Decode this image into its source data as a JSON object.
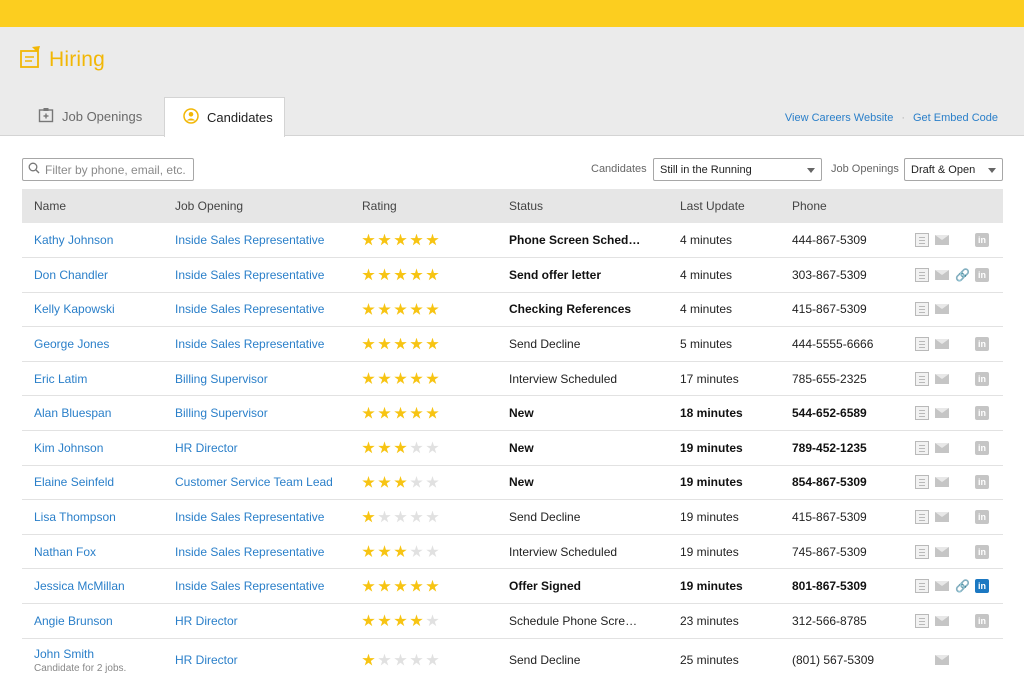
{
  "app": {
    "title": "Hiring"
  },
  "tabs": {
    "jobs": "Job Openings",
    "candidates": "Candidates"
  },
  "links": {
    "careers": "View Careers Website",
    "separator": "·",
    "embed": "Get Embed Code"
  },
  "filter": {
    "placeholder": "Filter by phone, email, etc..."
  },
  "selects": {
    "candidates_label": "Candidates",
    "candidates_value": "Still in the Running",
    "jobs_label": "Job Openings",
    "jobs_value": "Draft & Open"
  },
  "table": {
    "headers": [
      "Name",
      "Job Opening",
      "Rating",
      "Status",
      "Last Update",
      "Phone"
    ],
    "rows": [
      {
        "name": "Kathy Johnson",
        "job": "Inside Sales Representative",
        "rating": 5,
        "status": "Phone Screen Sched…",
        "update": "4 minutes",
        "phone": "444-867-5309",
        "bold_status": true,
        "bold_rest": false,
        "icons": [
          "resume",
          "mail",
          null,
          "in"
        ]
      },
      {
        "name": "Don Chandler",
        "job": "Inside Sales Representative",
        "rating": 5,
        "status": "Send offer letter",
        "update": "4 minutes",
        "phone": "303-867-5309",
        "bold_status": true,
        "bold_rest": false,
        "icons": [
          "resume",
          "mail",
          "link",
          "in"
        ]
      },
      {
        "name": "Kelly Kapowski",
        "job": "Inside Sales Representative",
        "rating": 5,
        "status": "Checking References",
        "update": "4 minutes",
        "phone": "415-867-5309",
        "bold_status": true,
        "bold_rest": false,
        "icons": [
          "resume",
          "mail",
          null,
          null
        ]
      },
      {
        "name": "George Jones",
        "job": "Inside Sales Representative",
        "rating": 5,
        "status": "Send Decline",
        "update": "5 minutes",
        "phone": "444-5555-6666",
        "bold_status": false,
        "bold_rest": false,
        "icons": [
          "resume",
          "mail",
          null,
          "in"
        ]
      },
      {
        "name": "Eric Latim",
        "job": "Billing Supervisor",
        "rating": 5,
        "status": "Interview Scheduled",
        "update": "17 minutes",
        "phone": "785-655-2325",
        "bold_status": false,
        "bold_rest": false,
        "icons": [
          "resume",
          "mail",
          null,
          "in"
        ]
      },
      {
        "name": "Alan Bluespan",
        "job": "Billing Supervisor",
        "rating": 5,
        "status": "New",
        "update": "18 minutes",
        "phone": "544-652-6589",
        "bold_status": true,
        "bold_rest": true,
        "icons": [
          "resume",
          "mail",
          null,
          "in"
        ]
      },
      {
        "name": "Kim Johnson",
        "job": "HR Director",
        "rating": 3,
        "status": "New",
        "update": "19 minutes",
        "phone": "789-452-1235",
        "bold_status": true,
        "bold_rest": true,
        "icons": [
          "resume",
          "mail",
          null,
          "in"
        ]
      },
      {
        "name": "Elaine Seinfeld",
        "job": "Customer Service Team Lead",
        "rating": 3,
        "status": "New",
        "update": "19 minutes",
        "phone": "854-867-5309",
        "bold_status": true,
        "bold_rest": true,
        "icons": [
          "resume",
          "mail",
          null,
          "in"
        ]
      },
      {
        "name": "Lisa Thompson",
        "job": "Inside Sales Representative",
        "rating": 1,
        "status": "Send Decline",
        "update": "19 minutes",
        "phone": "415-867-5309",
        "bold_status": false,
        "bold_rest": false,
        "icons": [
          "resume",
          "mail",
          null,
          "in"
        ]
      },
      {
        "name": "Nathan Fox",
        "job": "Inside Sales Representative",
        "rating": 3,
        "status": "Interview Scheduled",
        "update": "19 minutes",
        "phone": "745-867-5309",
        "bold_status": false,
        "bold_rest": false,
        "icons": [
          "resume",
          "mail",
          null,
          "in"
        ]
      },
      {
        "name": "Jessica McMillan",
        "job": "Inside Sales Representative",
        "rating": 5,
        "status": "Offer Signed",
        "update": "19 minutes",
        "phone": "801-867-5309",
        "bold_status": true,
        "bold_rest": true,
        "icons": [
          "resume",
          "mail",
          "link",
          "in-active"
        ]
      },
      {
        "name": "Angie Brunson",
        "job": "HR Director",
        "rating": 4,
        "status": "Schedule Phone Scre…",
        "update": "23 minutes",
        "phone": "312-566-8785",
        "bold_status": false,
        "bold_rest": false,
        "icons": [
          "resume",
          "mail",
          null,
          "in"
        ]
      },
      {
        "name": "John Smith",
        "sub": "Candidate for 2 jobs.",
        "job": "HR Director",
        "rating": 1,
        "status": "Send Decline",
        "update": "25 minutes",
        "phone": "(801) 567-5309",
        "bold_status": false,
        "bold_rest": false,
        "icons": [
          null,
          "mail",
          null,
          null
        ]
      }
    ]
  },
  "colors": {
    "brand": "#fcce1f",
    "link": "#2a7fc9",
    "star": "#f7c413",
    "linkedin_active": "#1b78c2"
  },
  "icons": {
    "logo": "hiring-logo-icon",
    "jobs_tab": "job-board-icon",
    "candidates_tab": "person-circle-icon",
    "search": "search-icon"
  }
}
